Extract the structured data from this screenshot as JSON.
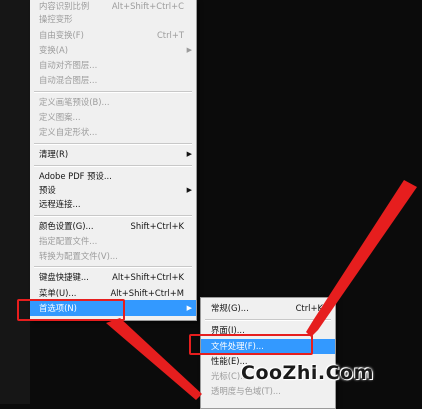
{
  "menu": {
    "items": [
      {
        "label": "内容识别比例",
        "shortcut": "Alt+Shift+Ctrl+C",
        "disabled": true
      },
      {
        "label": "操控变形",
        "disabled": true
      },
      {
        "label": "自由变换(F)",
        "shortcut": "Ctrl+T",
        "disabled": true
      },
      {
        "label": "变换(A)",
        "disabled": true,
        "submenu": true
      },
      {
        "label": "自动对齐图层...",
        "disabled": true
      },
      {
        "label": "自动混合图层...",
        "disabled": true
      },
      {
        "label": "定义画笔预设(B)...",
        "disabled": true
      },
      {
        "label": "定义图案...",
        "disabled": true
      },
      {
        "label": "定义自定形状...",
        "disabled": true
      },
      {
        "label": "清理(R)",
        "submenu": true
      },
      {
        "label": "Adobe PDF 预设..."
      },
      {
        "label": "预设",
        "submenu": true
      },
      {
        "label": "远程连接..."
      },
      {
        "label": "颜色设置(G)...",
        "shortcut": "Shift+Ctrl+K"
      },
      {
        "label": "指定配置文件...",
        "disabled": true
      },
      {
        "label": "转换为配置文件(V)...",
        "disabled": true
      },
      {
        "label": "键盘快捷键...",
        "shortcut": "Alt+Shift+Ctrl+K"
      },
      {
        "label": "菜单(U)...",
        "shortcut": "Alt+Shift+Ctrl+M"
      },
      {
        "label": "首选项(N)",
        "submenu": true,
        "highlighted": true
      }
    ]
  },
  "submenu": {
    "items": [
      {
        "label": "常规(G)...",
        "shortcut": "Ctrl+K"
      },
      {
        "label": "界面(I)..."
      },
      {
        "label": "文件处理(F)...",
        "highlighted": true
      },
      {
        "label": "性能(E)..."
      },
      {
        "label": "光标(C)...",
        "disabled": true
      },
      {
        "label": "透明度与色域(T)...",
        "disabled": true
      }
    ]
  },
  "watermark": "CooZhi.Com",
  "colors": {
    "highlight": "#3399ff",
    "annotation": "#e61e1e"
  },
  "icons": {
    "submenu_arrow": "triangle-right-icon"
  }
}
